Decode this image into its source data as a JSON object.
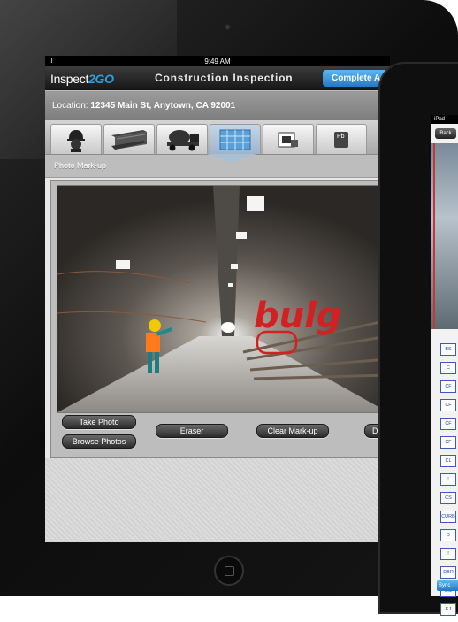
{
  "status_bar": {
    "time": "9:49 AM"
  },
  "nav": {
    "logo_prefix": "Inspect",
    "logo_brand": "2GO",
    "title": "Construction Inspection",
    "complete_button": "Complete A"
  },
  "location": {
    "label": "Location:",
    "value": "12345 Main St, Anytown, CA  92001"
  },
  "tabs": [
    {
      "name": "worker-icon"
    },
    {
      "name": "steel-beam-icon"
    },
    {
      "name": "concrete-truck-icon"
    },
    {
      "name": "photo-markup-icon"
    },
    {
      "name": "inspection-camera-icon"
    },
    {
      "name": "lead-pb-icon",
      "label": "Pb"
    }
  ],
  "section": {
    "title": "Photo Mark-up"
  },
  "photo": {
    "markup_text": "bulg"
  },
  "buttons": {
    "take_photo": "Take Photo",
    "browse_photos": "Browse Photos",
    "eraser": "Eraser",
    "clear_markup": "Clear Mark-up",
    "done_partial": "Do"
  },
  "second_device": {
    "status": "iPad",
    "back": "Back",
    "items": [
      "BS",
      "C",
      "CF",
      "CF",
      "CF",
      "CF",
      "CL",
      "!",
      "CS",
      "CURB",
      "D",
      "!",
      "DBR",
      "EC",
      "EJ"
    ],
    "sync": "Sync"
  },
  "colors": {
    "accent": "#2c9fe0",
    "markup": "#d42020"
  }
}
